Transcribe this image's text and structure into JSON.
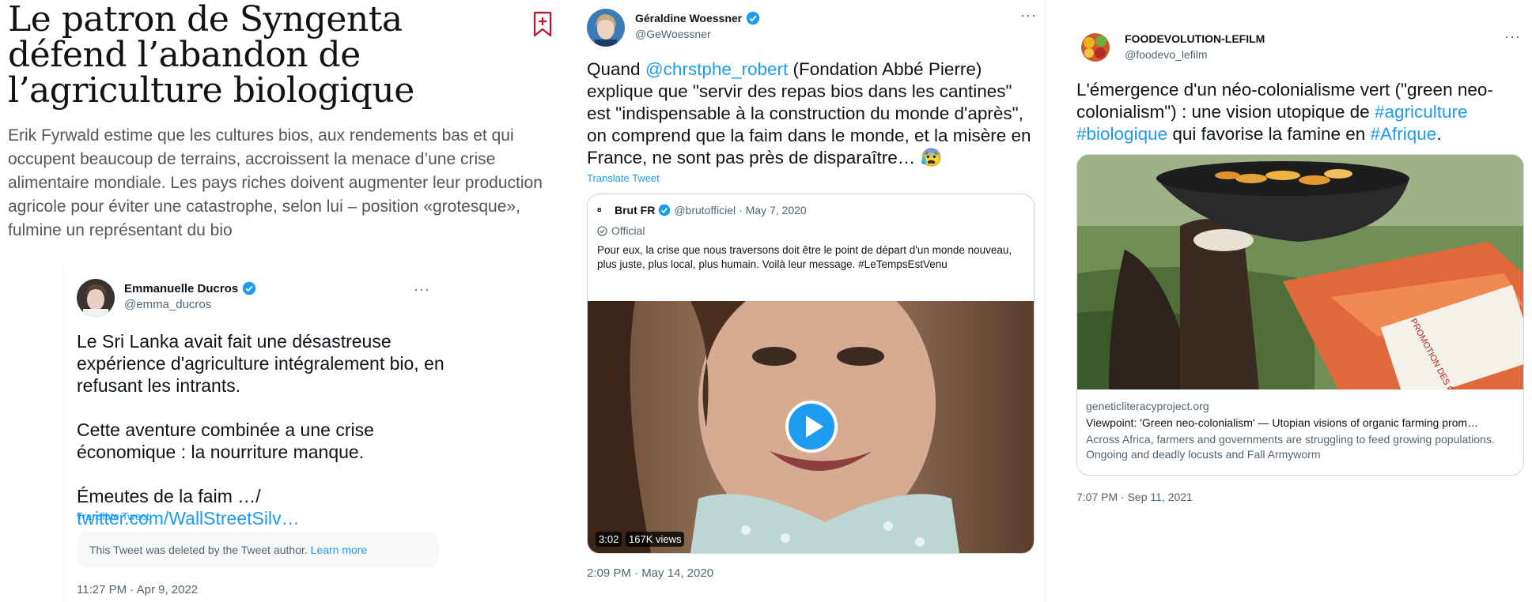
{
  "article": {
    "headline": "Le patron de Syngenta défend l’abandon de l’agriculture biologique",
    "lede": "Erik Fyrwald estime que les cultures bios, aux rendements bas et qui occupent beaucoup de terrains, accroissent la menace d’une crise alimentaire mondiale. Les pays riches doivent augmenter leur production agricole pour éviter une catastrophe, selon lui – position «grotesque», fulmine un représentant du bio",
    "bookmark_icon": "bookmark-plus-icon",
    "accent_color": "#c8102e"
  },
  "tweet1": {
    "name": "Emmanuelle Ducros",
    "handle": "@emma_ducros",
    "paragraphs": [
      "Le Sri Lanka avait fait une désastreuse expérience d'agriculture intégralement bio, en refusant les intrants.",
      "Cette aventure combinée a une crise économique : la nourriture manque."
    ],
    "last_line_prefix": "Émeutes de la faim …/ ",
    "last_line_link": "twitter.com/WallStreetSilv…",
    "translate": "Translate Tweet",
    "deleted_notice": "This Tweet was deleted by the Tweet author.",
    "deleted_learn_more": "Learn more",
    "timestamp": "11:27 PM · Apr 9, 2022"
  },
  "tweet2": {
    "name": "Géraldine Woessner",
    "handle": "@GeWoessner",
    "text_prefix": "Quand ",
    "mention": "@chrstphe_robert",
    "text_suffix": " (Fondation Abbé Pierre) explique que \"servir des repas bios dans les cantines\" est \"indispensable à la construction du monde d'après\", on comprend que la faim dans le monde, et la misère en France, ne sont pas près de disparaître… 😰",
    "translate": "Translate Tweet",
    "timestamp": "2:09 PM · May 14, 2020",
    "quote": {
      "name": "Brut FR",
      "handle": "@brutofficiel",
      "date": "· May 7, 2020",
      "label": "Official",
      "text": "Pour eux, la crise que nous traversons doit être le point de départ d'un monde nouveau, plus juste, plus local, plus humain. Voilà leur message. #LeTempsEstVenu",
      "video_duration": "3:02",
      "video_views": "167K views"
    }
  },
  "tweet3": {
    "name": "FOODEVOLUTION-LEFILM",
    "handle": "@foodevo_lefilm",
    "text_prefix": "L'émergence d'un néo-colonialisme vert (\"green neo-colonialism\") : une vision utopique de ",
    "hashtag1": "#agriculture",
    "hashtag2": "#biologique",
    "text_mid": " qui favorise la famine en ",
    "hashtag3": "#Afrique",
    "text_end": ".",
    "card_domain": "geneticliteracyproject.org",
    "card_title": "Viewpoint: 'Green neo-colonialism' — Utopian visions of organic farming prom…",
    "card_desc": "Across Africa, farmers and governments are struggling to feed growing populations. Ongoing and deadly locusts and Fall Armyworm",
    "photo_sign": "PROMOTION DES CE",
    "timestamp": "7:07 PM · Sep 11, 2021"
  },
  "colors": {
    "link": "#1d9bf0",
    "secondary_text": "#536471",
    "verified": "#1d9bf0"
  }
}
